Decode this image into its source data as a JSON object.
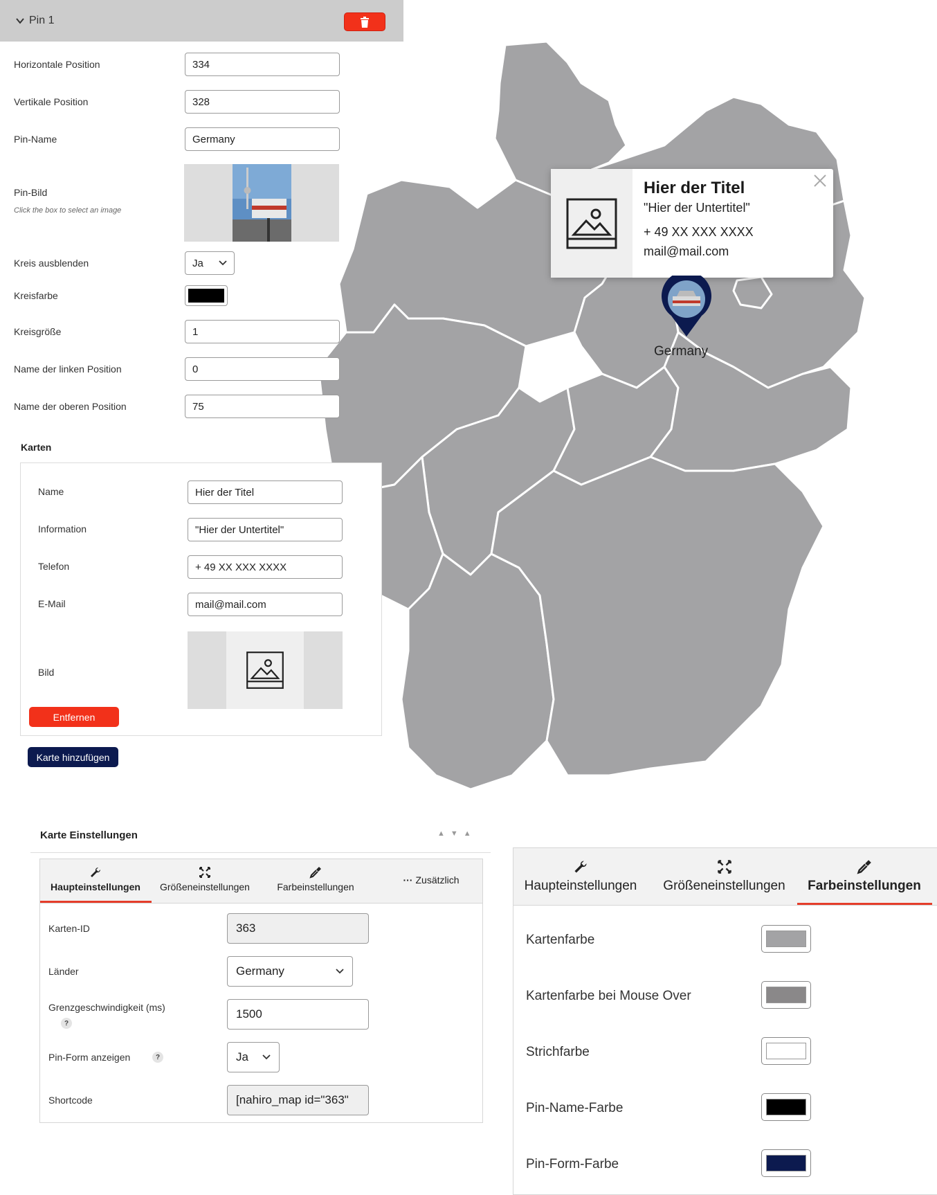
{
  "pin": {
    "title": "Pin 1",
    "fields": [
      {
        "label": "Horizontale Position",
        "value": "334"
      },
      {
        "label": "Vertikale Position",
        "value": "328"
      },
      {
        "label": "Pin-Name",
        "value": "Germany"
      }
    ],
    "image_label": "Pin-Bild",
    "image_hint": "Click the box to select an image",
    "hide_circle_label": "Kreis ausblenden",
    "hide_circle_value": "Ja",
    "circle_color_label": "Kreisfarbe",
    "circle_color": "#000000",
    "fields2": [
      {
        "label": "Kreisgröße",
        "value": "1"
      },
      {
        "label": "Name der linken Position",
        "value": "0"
      },
      {
        "label": "Name der oberen Position",
        "value": "75"
      }
    ]
  },
  "karten": {
    "title": "Karten",
    "fields": [
      {
        "label": "Name",
        "value": "Hier der Titel"
      },
      {
        "label": "Information",
        "value": "\"Hier der Untertitel\""
      },
      {
        "label": "Telefon",
        "value": "+ 49 XX XXX XXXX"
      },
      {
        "label": "E-Mail",
        "value": "mail@mail.com"
      }
    ],
    "image_label": "Bild",
    "remove_label": "Entfernen",
    "add_label": "Karte hinzufügen"
  },
  "popup": {
    "title": "Hier der Titel",
    "subtitle": "\"Hier der Untertitel\"",
    "phone": "+ 49 XX XXX XXXX",
    "email": "mail@mail.com"
  },
  "map": {
    "pin_label": "Germany",
    "fill": "#a3a3a5",
    "stroke": "#ffffff",
    "pin_color": "#0c1a4f"
  },
  "settings": {
    "title": "Karte Einstellungen",
    "tabs": [
      "Haupteinstellungen",
      "Größeneinstellungen",
      "Farbeinstellungen",
      "Zusätzlich"
    ],
    "rows": {
      "map_id_label": "Karten-ID",
      "map_id_value": "363",
      "countries_label": "Länder",
      "countries_value": "Germany",
      "speed_label": "Grenzgeschwindigkeit (ms)",
      "speed_value": "1500",
      "pin_shape_label": "Pin-Form anzeigen",
      "pin_shape_value": "Ja",
      "shortcode_label": "Shortcode",
      "shortcode_value": "[nahiro_map id=\"363\""
    }
  },
  "colors": {
    "tabs": [
      "Haupteinstellungen",
      "Größeneinstellungen",
      "Farbeinstellungen"
    ],
    "items": [
      {
        "label": "Kartenfarbe",
        "color": "#a3a3a5"
      },
      {
        "label": "Kartenfarbe bei Mouse Over",
        "color": "#8a8889"
      },
      {
        "label": "Strichfarbe",
        "color": "#ffffff"
      },
      {
        "label": "Pin-Name-Farbe",
        "color": "#000000"
      },
      {
        "label": "Pin-Form-Farbe",
        "color": "#0c1a4f"
      }
    ]
  }
}
